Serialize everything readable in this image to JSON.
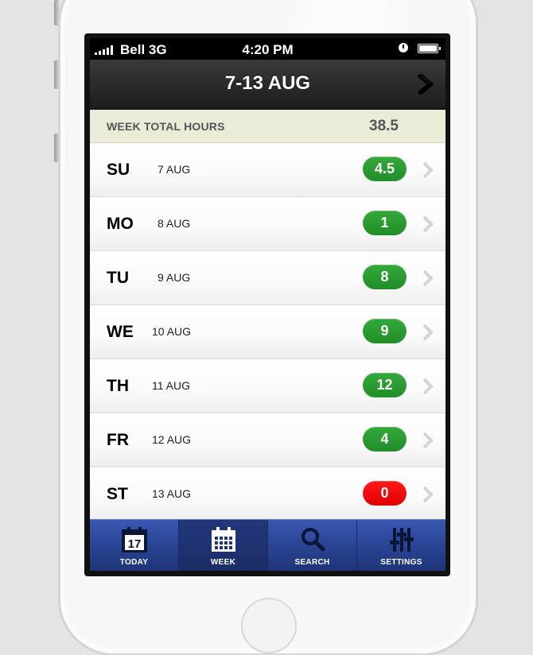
{
  "status_bar": {
    "carrier": "Bell 3G",
    "time": "4:20 PM"
  },
  "nav": {
    "title": "7-13 AUG"
  },
  "summary": {
    "label": "WEEK TOTAL HOURS",
    "value": "38.5"
  },
  "days": [
    {
      "code": "SU",
      "date": "7 AUG",
      "hours": "4.5",
      "status": "positive"
    },
    {
      "code": "MO",
      "date": "8 AUG",
      "hours": "1",
      "status": "positive"
    },
    {
      "code": "TU",
      "date": "9 AUG",
      "hours": "8",
      "status": "positive"
    },
    {
      "code": "WE",
      "date": "10 AUG",
      "hours": "9",
      "status": "positive"
    },
    {
      "code": "TH",
      "date": "11 AUG",
      "hours": "12",
      "status": "positive"
    },
    {
      "code": "FR",
      "date": "12 AUG",
      "hours": "4",
      "status": "positive"
    },
    {
      "code": "ST",
      "date": "13 AUG",
      "hours": "0",
      "status": "zero"
    }
  ],
  "tabs": [
    {
      "label": "TODAY",
      "icon": "calendar-day-icon",
      "active": false
    },
    {
      "label": "WEEK",
      "icon": "calendar-week-icon",
      "active": true
    },
    {
      "label": "SEARCH",
      "icon": "search-icon",
      "active": false
    },
    {
      "label": "SETTINGS",
      "icon": "settings-sliders-icon",
      "active": false
    }
  ],
  "today_icon_day": "17",
  "colors": {
    "badge_positive": "#2a9a30",
    "badge_zero": "#f00000",
    "tab_bar": "#2a4494",
    "summary_bg": "#ecebd8"
  }
}
